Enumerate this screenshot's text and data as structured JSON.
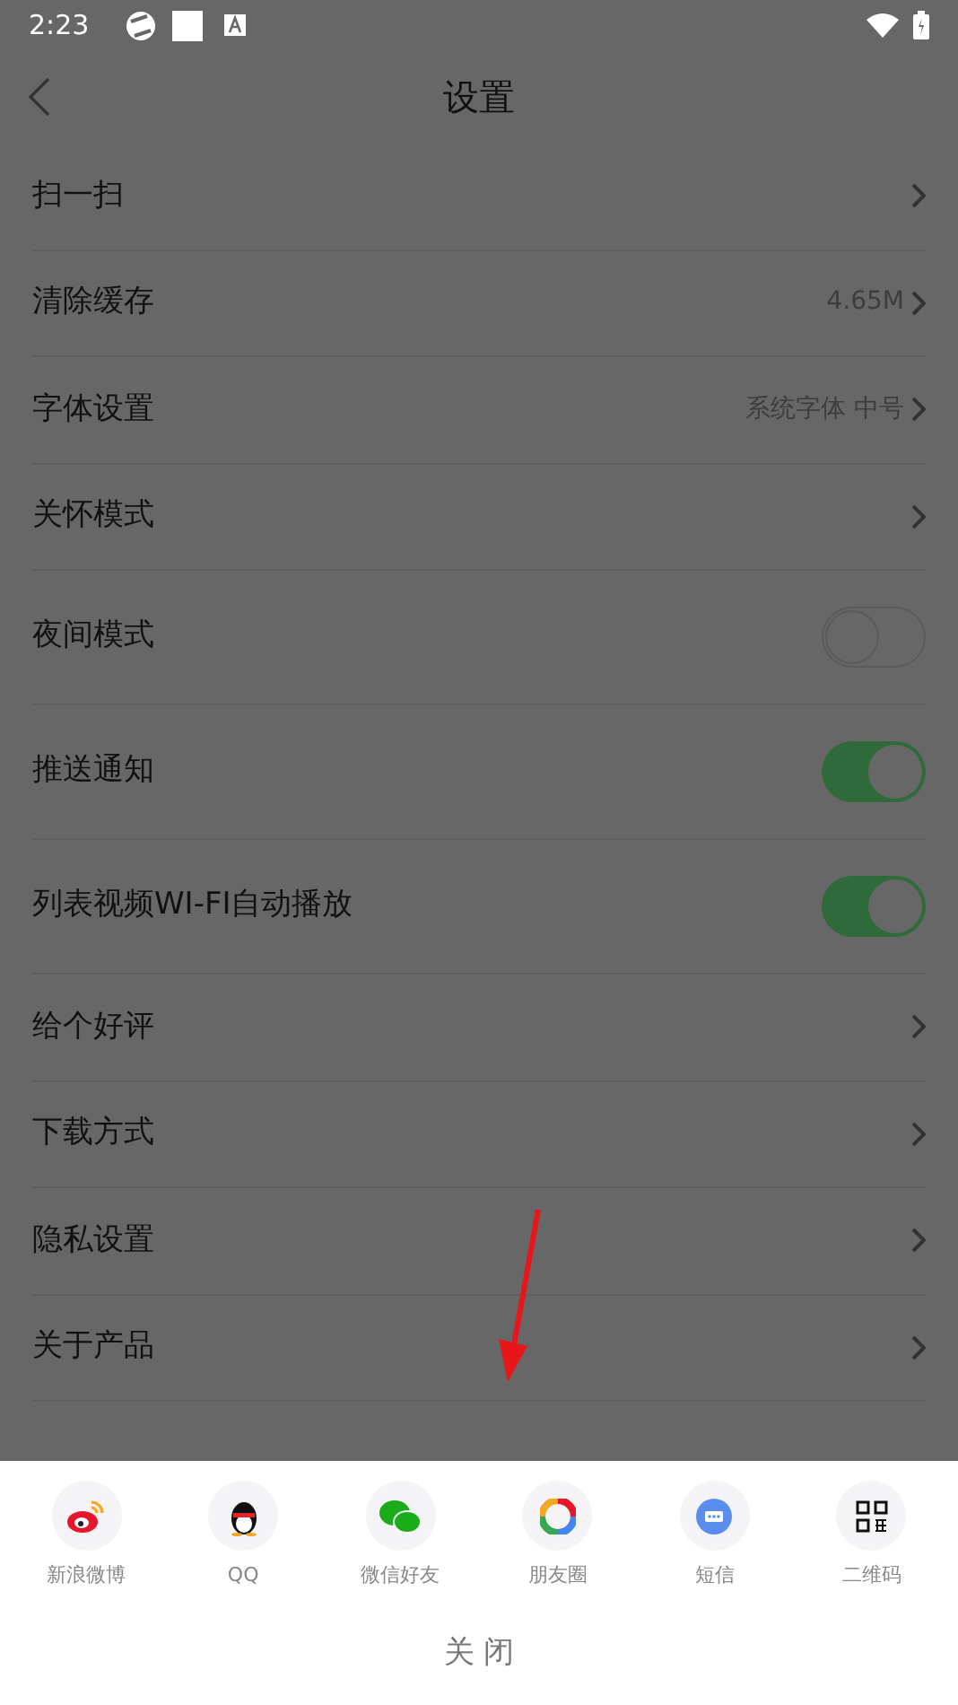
{
  "status_bar": {
    "time": "2:23"
  },
  "header": {
    "title": "设置"
  },
  "settings": [
    {
      "kind": "link",
      "label": "扫一扫"
    },
    {
      "kind": "link",
      "label": "清除缓存",
      "value": "4.65M"
    },
    {
      "kind": "link",
      "label": "字体设置",
      "value": "系统字体 中号"
    },
    {
      "kind": "link",
      "label": "关怀模式"
    },
    {
      "kind": "switch",
      "label": "夜间模式",
      "on": false
    },
    {
      "kind": "switch",
      "label": "推送通知",
      "on": true
    },
    {
      "kind": "switch",
      "label": "列表视频WI-FI自动播放",
      "on": true
    },
    {
      "kind": "link",
      "label": "给个好评"
    },
    {
      "kind": "link",
      "label": "下载方式"
    },
    {
      "kind": "link",
      "label": "隐私设置"
    },
    {
      "kind": "link",
      "label": "关于产品"
    }
  ],
  "share_sheet": {
    "targets": [
      {
        "kind": "weibo",
        "label": "新浪微博"
      },
      {
        "kind": "qq",
        "label": "QQ"
      },
      {
        "kind": "wechat",
        "label": "微信好友"
      },
      {
        "kind": "moments",
        "label": "朋友圈"
      },
      {
        "kind": "sms",
        "label": "短信"
      },
      {
        "kind": "qrcode",
        "label": "二维码"
      }
    ],
    "close": "关 闭"
  }
}
